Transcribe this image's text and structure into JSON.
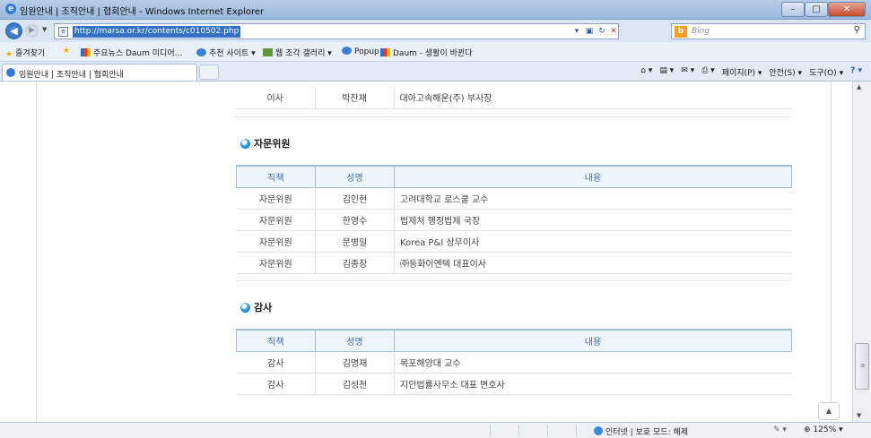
{
  "window": {
    "title": "임원안내 | 조직안내 | 협회안내 - Windows Internet Explorer",
    "min": "–",
    "max": "□",
    "close": "✕"
  },
  "address": {
    "back": "◀",
    "forward": "▶",
    "url": "http://marsa.or.kr/contents/c010502.php",
    "compat": "▣",
    "refresh": "↻",
    "stop": "✕"
  },
  "search": {
    "brand": "b",
    "placeholder": "Bing",
    "go": "⚲"
  },
  "favorites": {
    "label": "즐겨찾기",
    "items": [
      {
        "label": "주요뉴스  Daum 미디어...",
        "icon": "daum-feed-icon"
      },
      {
        "label": "추천 사이트 ▾",
        "icon": "ie-page-icon"
      },
      {
        "label": "웹 조각 갤러리 ▾",
        "icon": "web-slice-icon"
      },
      {
        "label": "Popup",
        "icon": "ie-page-icon"
      },
      {
        "label": "Daum - 생활이 바뀐다",
        "icon": "daum-feed-icon"
      }
    ]
  },
  "tab": {
    "label": "임원안내 | 조직안내 | 협회안내"
  },
  "commandbar": {
    "home": "⌂ ▾",
    "feeds": "▤ ▾",
    "mail": "✉ ▾",
    "print": "⎙ ▾",
    "page": "페이지(P) ▾",
    "safety": "안전(S) ▾",
    "tools": "도구(O) ▾",
    "help": "? ▾"
  },
  "page": {
    "top_row": {
      "position": "이사",
      "name": "박찬재",
      "detail": "대아고속해운(주) 부사장"
    },
    "advisors": {
      "title": "자문위원",
      "headers": [
        "직책",
        "성명",
        "내용"
      ],
      "rows": [
        {
          "position": "자문위원",
          "name": "김인현",
          "detail": "고려대학교 로스쿨 교수"
        },
        {
          "position": "자문위원",
          "name": "한영수",
          "detail": "법제처 행정법제 국장"
        },
        {
          "position": "자문위원",
          "name": "문병일",
          "detail": "Korea P&I 상무이사"
        },
        {
          "position": "자문위원",
          "name": "김종창",
          "detail": "㈜동화이엔텍 대표이사"
        }
      ]
    },
    "auditors": {
      "title": "감사",
      "headers": [
        "직책",
        "성명",
        "내용"
      ],
      "rows": [
        {
          "position": "감사",
          "name": "김명재",
          "detail": "목포해양대 교수"
        },
        {
          "position": "감사",
          "name": "김성천",
          "detail": "지안법률사무소 대표 변호사"
        }
      ]
    },
    "back_to_top": "▲"
  },
  "status": {
    "zone": "인터넷 | 보호 모드: 해제",
    "zoom": "125%",
    "zoom_arrow": "▾"
  }
}
